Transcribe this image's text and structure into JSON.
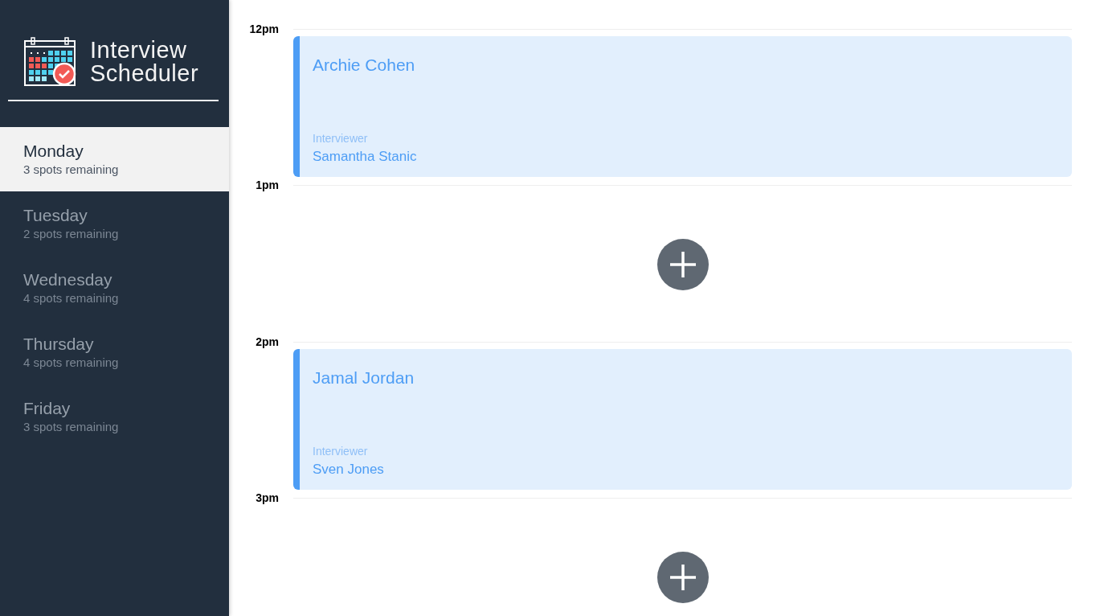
{
  "sidebar": {
    "title_lines": [
      "Interview",
      "Scheduler"
    ],
    "days": [
      {
        "name": "Monday",
        "spots": "3 spots remaining",
        "selected": true
      },
      {
        "name": "Tuesday",
        "spots": "2 spots remaining",
        "selected": false
      },
      {
        "name": "Wednesday",
        "spots": "4 spots remaining",
        "selected": false
      },
      {
        "name": "Thursday",
        "spots": "4 spots remaining",
        "selected": false
      },
      {
        "name": "Friday",
        "spots": "3 spots remaining",
        "selected": false
      }
    ]
  },
  "schedule": {
    "slots": [
      {
        "time": "12pm",
        "kind": "appointment",
        "student": "Archie Cohen",
        "interviewer_label": "Interviewer",
        "interviewer": "Samantha Stanic"
      },
      {
        "time": "1pm",
        "kind": "empty"
      },
      {
        "time": "2pm",
        "kind": "appointment",
        "student": "Jamal Jordan",
        "interviewer_label": "Interviewer",
        "interviewer": "Sven Jones"
      },
      {
        "time": "3pm",
        "kind": "empty"
      }
    ]
  }
}
